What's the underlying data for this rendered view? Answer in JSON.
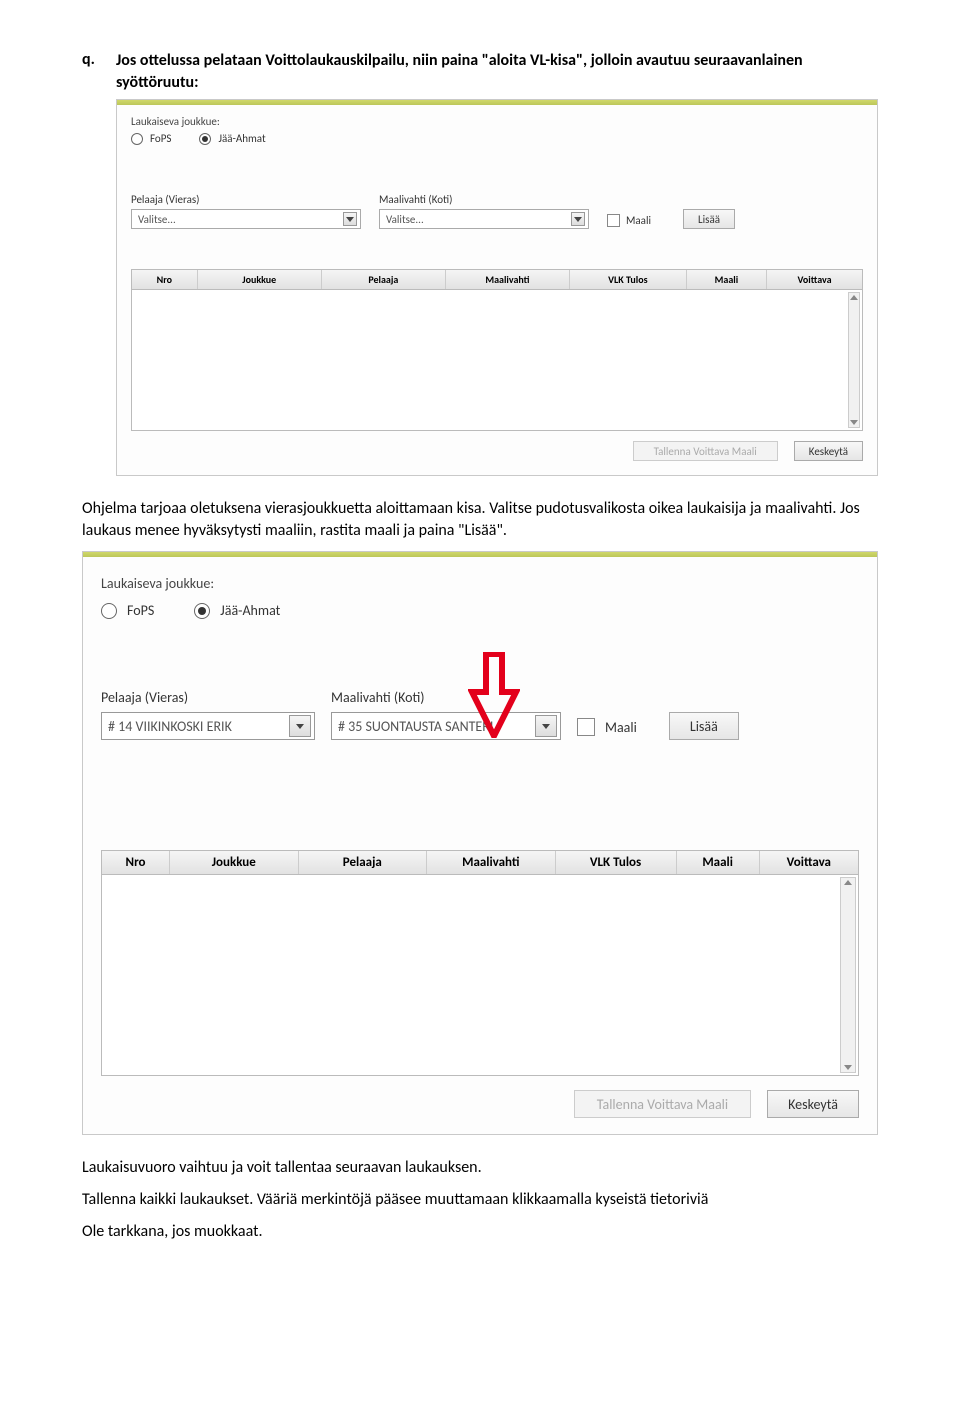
{
  "para_q": {
    "marker": "q.",
    "text": "Jos ottelussa pelataan Voittolaukauskilpailu, niin paina \"aloita VL-kisa\", jolloin avautuu seuraavanlainen syöttöruutu:"
  },
  "para_mid": "Ohjelma tarjoaa oletuksena vierasjoukkuetta aloittamaan kisa. Valitse pudotusvalikosta oikea laukaisija ja maalivahti. Jos laukaus menee hyväksytysti maaliin, rastita maali ja paina \"Lisää\".",
  "para_end_1": "Laukaisuvuoro vaihtuu ja voit tallentaa seuraavan laukauksen.",
  "para_end_2": "Tallenna kaikki laukaukset. Vääriä merkintöjä pääsee muuttamaan klikkaamalla kyseistä tietoriviä",
  "para_end_3": "Ole tarkkana, jos muokkaat.",
  "panel1": {
    "shootingTeamLabel": "Laukaiseva joukkue:",
    "team1": "FoPS",
    "team2": "Jää-Ahmat",
    "playerLabel": "Pelaaja (Vieras)",
    "playerValue": "Valitse...",
    "goalieLabel": "Maalivahti (Koti)",
    "goalieValue": "Valitse...",
    "checkboxLabel": "Maali",
    "addBtn": "Lisää",
    "cols": [
      "Nro",
      "Joukkue",
      "Pelaaja",
      "Maalivahti",
      "VLK Tulos",
      "Maali",
      "Voittava"
    ],
    "saveBtn": "Tallenna Voittava Maali",
    "cancelBtn": "Keskeytä"
  },
  "panel2": {
    "shootingTeamLabel": "Laukaiseva joukkue:",
    "team1": "FoPS",
    "team2": "Jää-Ahmat",
    "playerLabel": "Pelaaja (Vieras)",
    "playerValue": "# 14 VIIKINKOSKI ERIK",
    "goalieLabel": "Maalivahti (Koti)",
    "goalieValue": "# 35 SUONTAUSTA SANTERI",
    "checkboxLabel": "Maali",
    "addBtn": "Lisää",
    "cols": [
      "Nro",
      "Joukkue",
      "Pelaaja",
      "Maalivahti",
      "VLK Tulos",
      "Maali",
      "Voittava"
    ],
    "saveBtn": "Tallenna Voittava Maali",
    "cancelBtn": "Keskeytä"
  }
}
